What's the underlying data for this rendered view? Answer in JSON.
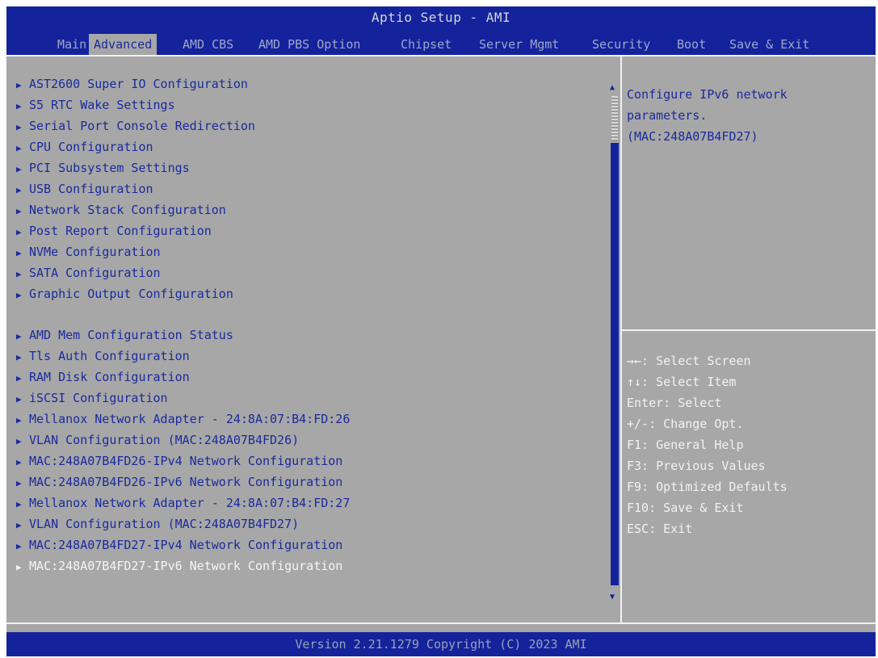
{
  "app": {
    "title": "Aptio Setup - AMI"
  },
  "tabs": [
    {
      "label": "Main",
      "active": false
    },
    {
      "label": "Advanced",
      "active": true
    },
    {
      "label": "AMD CBS",
      "active": false
    },
    {
      "label": "AMD PBS Option",
      "active": false
    },
    {
      "label": "Chipset",
      "active": false
    },
    {
      "label": "Server Mgmt",
      "active": false
    },
    {
      "label": "Security",
      "active": false
    },
    {
      "label": "Boot",
      "active": false
    },
    {
      "label": "Save & Exit",
      "active": false
    }
  ],
  "menu": {
    "items": [
      {
        "label": "AST2600 Super IO Configuration"
      },
      {
        "label": "S5 RTC Wake Settings"
      },
      {
        "label": "Serial Port Console Redirection"
      },
      {
        "label": "CPU Configuration"
      },
      {
        "label": "PCI Subsystem Settings"
      },
      {
        "label": "USB Configuration"
      },
      {
        "label": "Network Stack Configuration"
      },
      {
        "label": "Post Report Configuration"
      },
      {
        "label": "NVMe Configuration"
      },
      {
        "label": "SATA Configuration"
      },
      {
        "label": "Graphic Output Configuration"
      },
      {
        "label": "AMD Mem Configuration Status"
      },
      {
        "label": "Tls Auth Configuration"
      },
      {
        "label": "RAM Disk Configuration"
      },
      {
        "label": "iSCSI Configuration"
      },
      {
        "label": "Mellanox Network Adapter - 24:8A:07:B4:FD:26"
      },
      {
        "label": "VLAN Configuration (MAC:248A07B4FD26)"
      },
      {
        "label": "MAC:248A07B4FD26-IPv4 Network Configuration"
      },
      {
        "label": "MAC:248A07B4FD26-IPv6 Network Configuration"
      },
      {
        "label": "Mellanox Network Adapter - 24:8A:07:B4:FD:27"
      },
      {
        "label": "VLAN Configuration (MAC:248A07B4FD27)"
      },
      {
        "label": "MAC:248A07B4FD27-IPv4 Network Configuration"
      },
      {
        "label": "MAC:248A07B4FD27-IPv6 Network Configuration"
      }
    ],
    "selected_index": 22
  },
  "help": {
    "description": "Configure IPv6 network\nparameters.\n(MAC:248A07B4FD27)"
  },
  "keys": [
    {
      "text": "→←: Select Screen"
    },
    {
      "text": "↑↓: Select Item"
    },
    {
      "text": "Enter: Select"
    },
    {
      "text": "+/-: Change Opt."
    },
    {
      "text": "F1: General Help"
    },
    {
      "text": "F3: Previous Values"
    },
    {
      "text": "F9: Optimized Defaults"
    },
    {
      "text": "F10: Save & Exit"
    },
    {
      "text": "ESC: Exit"
    }
  ],
  "footer": {
    "version": "Version 2.21.1279 Copyright (C) 2023 AMI"
  },
  "icons": {
    "menu_arrow": "▶",
    "scroll_up": "▲",
    "scroll_down": "▼"
  },
  "colors": {
    "bar_blue": "#14239c",
    "panel_gray": "#a7a7a7",
    "text_blue": "#1a2a9e",
    "text_white": "#f5f5f5"
  }
}
